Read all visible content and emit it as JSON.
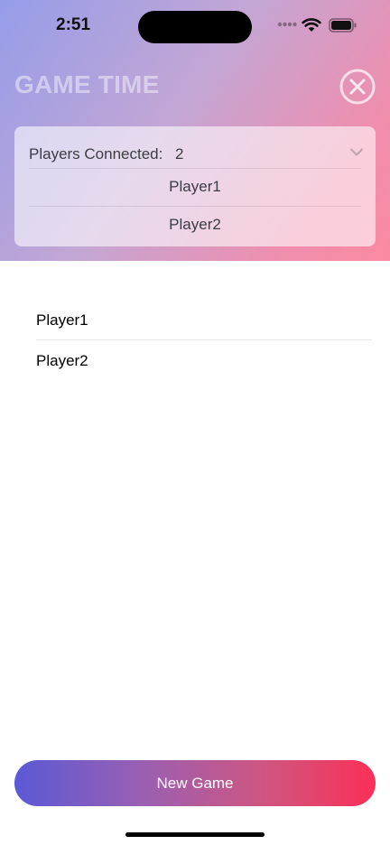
{
  "status_bar": {
    "time": "2:51",
    "icons": [
      "signal-dots-icon",
      "wifi-icon",
      "battery-icon"
    ]
  },
  "header": {
    "title": "GAME TIME",
    "close_icon": "close-circle-icon"
  },
  "players_card": {
    "label": "Players Connected:",
    "count": "2",
    "players": [
      "Player1",
      "Player2"
    ],
    "expanded_icon": "chevron-down-icon"
  },
  "main_list": {
    "items": [
      "Player1",
      "Player2"
    ]
  },
  "footer": {
    "new_game_label": "New Game"
  },
  "colors": {
    "header_gradient": [
      "#959de9",
      "#fb8aa0"
    ],
    "button_gradient": [
      "#5a59d6",
      "#fb2f57"
    ]
  }
}
